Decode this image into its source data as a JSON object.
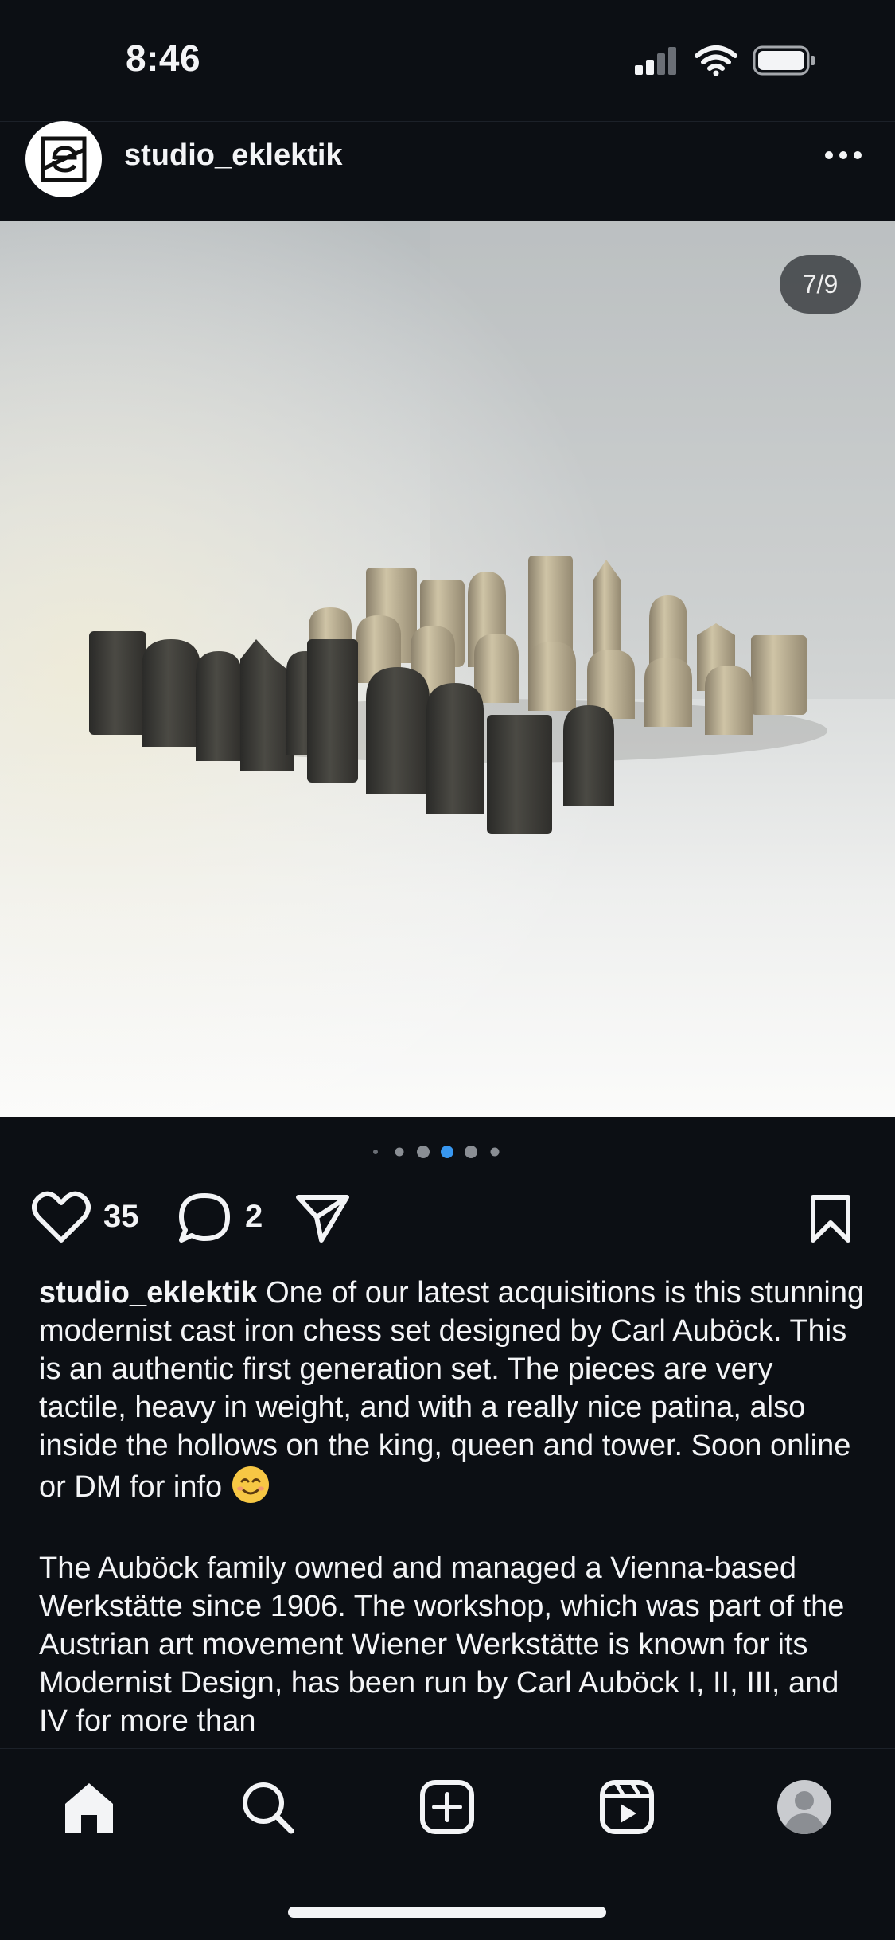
{
  "status_bar": {
    "time": "8:46",
    "icons": [
      "cellular-signal-icon",
      "wifi-icon",
      "battery-icon"
    ]
  },
  "post": {
    "username": "studio_eklektik",
    "image_counter": "7/9",
    "carousel": {
      "dot_count": 6,
      "active_dot": 3
    },
    "likes": "35",
    "comments": "2",
    "caption": {
      "username": "studio_eklektik",
      "paragraph1": "One of our latest acquisitions is this stunning modernist cast iron chess set designed by Carl Auböck. This is an authentic first generation set. The pieces are very tactile, heavy in weight, and with a really nice patina, also inside the hollows on the king, queen and tower. Soon online or DM for info",
      "paragraph2": "The Auböck family owned and managed a Vienna-based Werkstätte since 1906. The workshop, which was part of the Austrian art movement Wiener Werkstätte is known for its Modernist Design, has been run by Carl Auböck I, II, III, and IV for more than"
    }
  },
  "tab_bar": [
    "home-icon",
    "search-icon",
    "create-post-icon",
    "reels-icon",
    "profile-icon"
  ],
  "colors": {
    "background": "#0c0f14",
    "text": "#f3f4f6",
    "active_dot": "#3897f0"
  }
}
